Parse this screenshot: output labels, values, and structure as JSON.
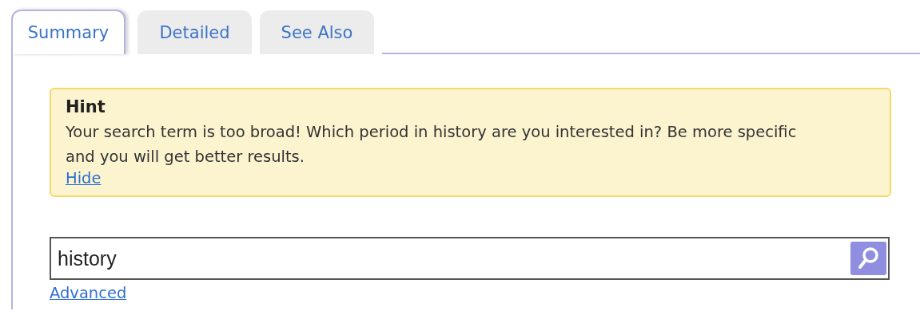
{
  "tabs": [
    {
      "label": "Summary",
      "selected": true
    },
    {
      "label": "Detailed",
      "selected": false
    },
    {
      "label": "See Also",
      "selected": false
    }
  ],
  "hint": {
    "title": "Hint",
    "message": "Your search term is too broad! Which period in history are you interested in? Be more specific and you will get better results.",
    "link": "Hide"
  },
  "search": {
    "value": "history"
  },
  "advanced_link": "Advanced"
}
